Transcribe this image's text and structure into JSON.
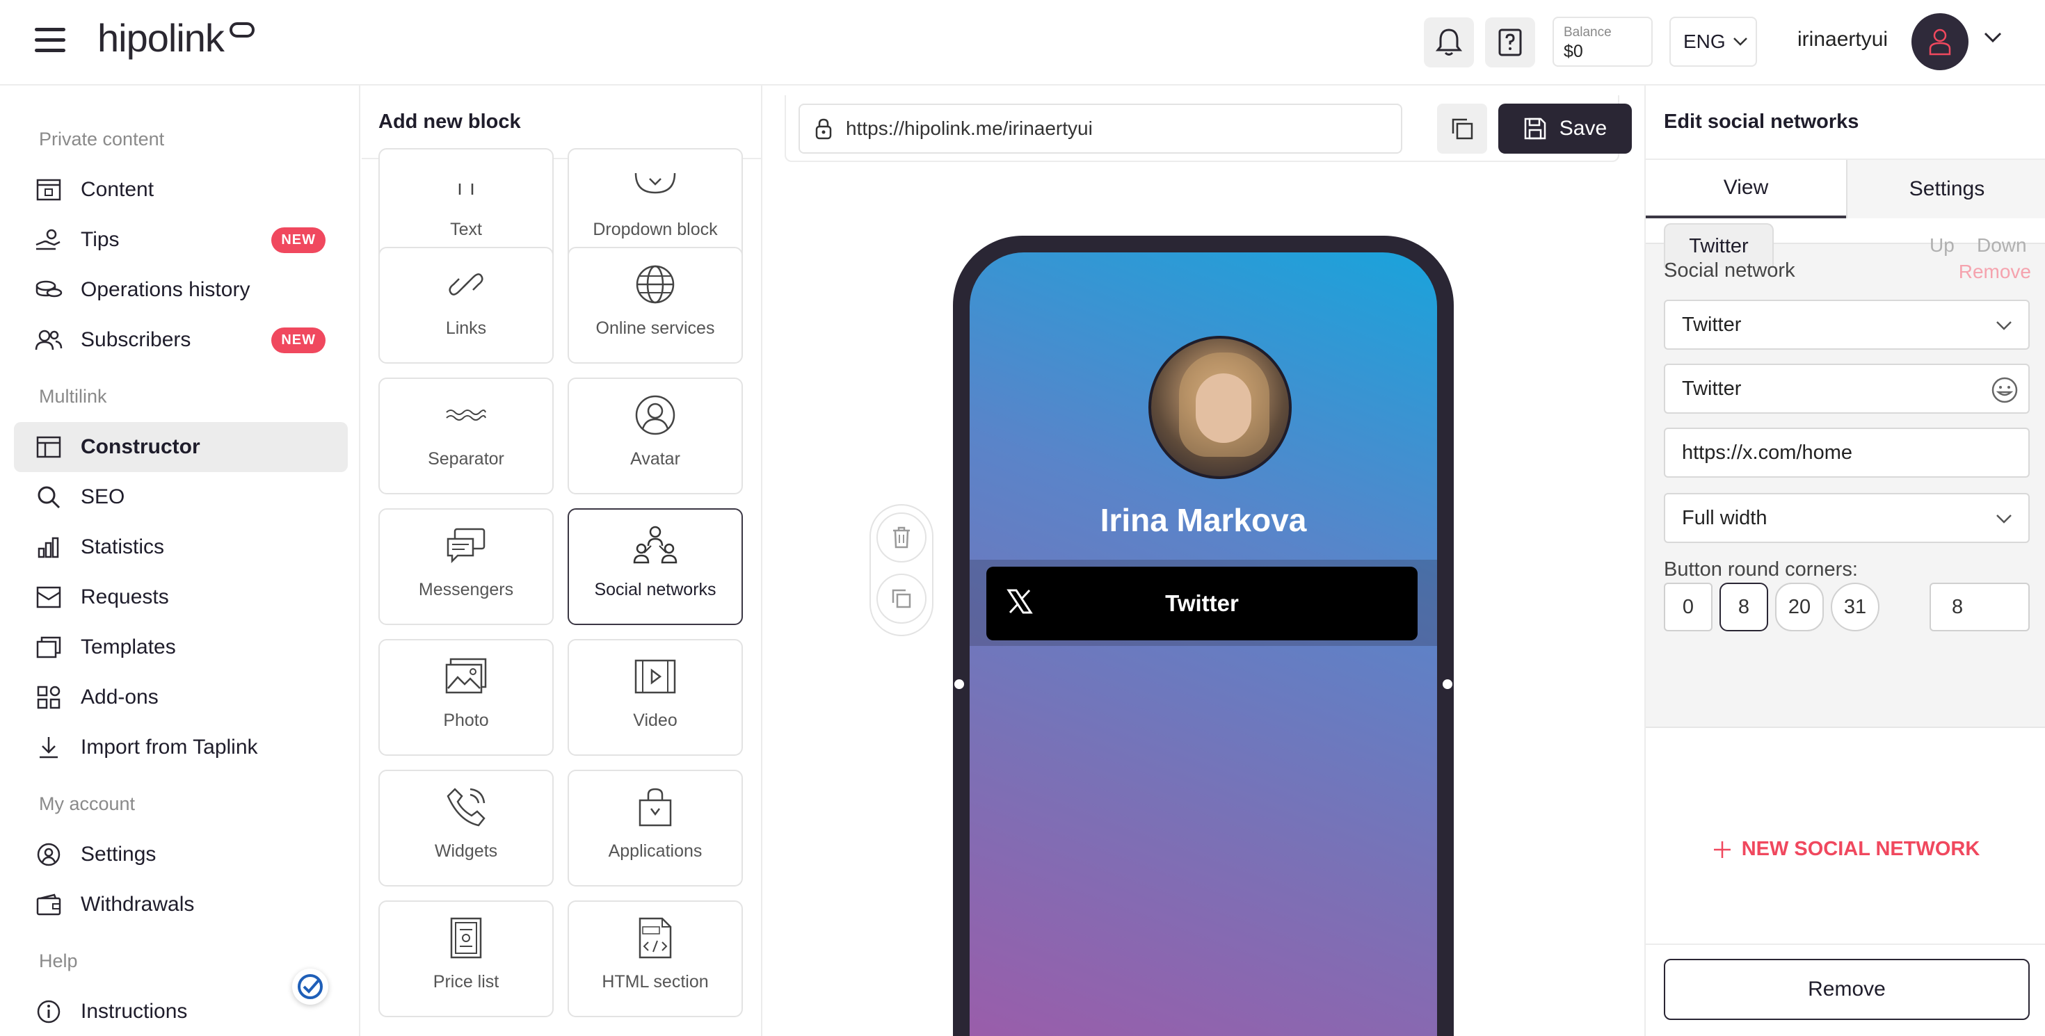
{
  "header": {
    "logo": "hipolink",
    "balance_label": "Balance",
    "balance_value": "$0",
    "language": "ENG",
    "username": "irinaertyui"
  },
  "sidebar": {
    "sections": [
      "Private content",
      "Multilink",
      "My account",
      "Help"
    ],
    "items": [
      {
        "label": "Content",
        "icon": "content-icon"
      },
      {
        "label": "Tips",
        "icon": "tips-hand-icon",
        "badge": "NEW"
      },
      {
        "label": "Operations history",
        "icon": "coins-icon"
      },
      {
        "label": "Subscribers",
        "icon": "users-icon",
        "badge": "NEW"
      },
      {
        "label": "Constructor",
        "icon": "layout-icon",
        "active": true
      },
      {
        "label": "SEO",
        "icon": "search-icon"
      },
      {
        "label": "Statistics",
        "icon": "bar-chart-icon"
      },
      {
        "label": "Requests",
        "icon": "inbox-icon"
      },
      {
        "label": "Templates",
        "icon": "templates-icon"
      },
      {
        "label": "Add-ons",
        "icon": "addons-icon"
      },
      {
        "label": "Import from Taplink",
        "icon": "download-icon"
      },
      {
        "label": "Settings",
        "icon": "gear-user-icon"
      },
      {
        "label": "Withdrawals",
        "icon": "wallet-icon"
      },
      {
        "label": "Instructions",
        "icon": "info-icon"
      }
    ]
  },
  "add_block": {
    "title": "Add new block",
    "tiles": [
      "Text",
      "Dropdown block",
      "Links",
      "Online services",
      "Separator",
      "Avatar",
      "Messengers",
      "Social networks",
      "Photo",
      "Video",
      "Widgets",
      "Applications",
      "Price list",
      "HTML section"
    ]
  },
  "preview": {
    "url": "https://hipolink.me/irinaertyui",
    "save_label": "Save",
    "profile_name": "Irina Markova",
    "button_label": "Twitter"
  },
  "edit_panel": {
    "title": "Edit social networks",
    "tabs": [
      "View",
      "Settings"
    ],
    "active_tab": "View",
    "subtab": "Twitter",
    "up": "Up",
    "down": "Down",
    "social_network_label": "Social network",
    "remove_link": "Remove",
    "network_select": "Twitter",
    "button_text": "Twitter",
    "link_url": "https://x.com/home",
    "width_select": "Full width",
    "corners_label": "Button round corners:",
    "corner_options": [
      "0",
      "8",
      "20",
      "31"
    ],
    "corner_selected": "8",
    "corner_custom": "8",
    "new_network": "NEW SOCIAL NETWORK",
    "remove_button": "Remove"
  },
  "colors": {
    "accent": "#f0485e",
    "dark": "#2a2634"
  }
}
